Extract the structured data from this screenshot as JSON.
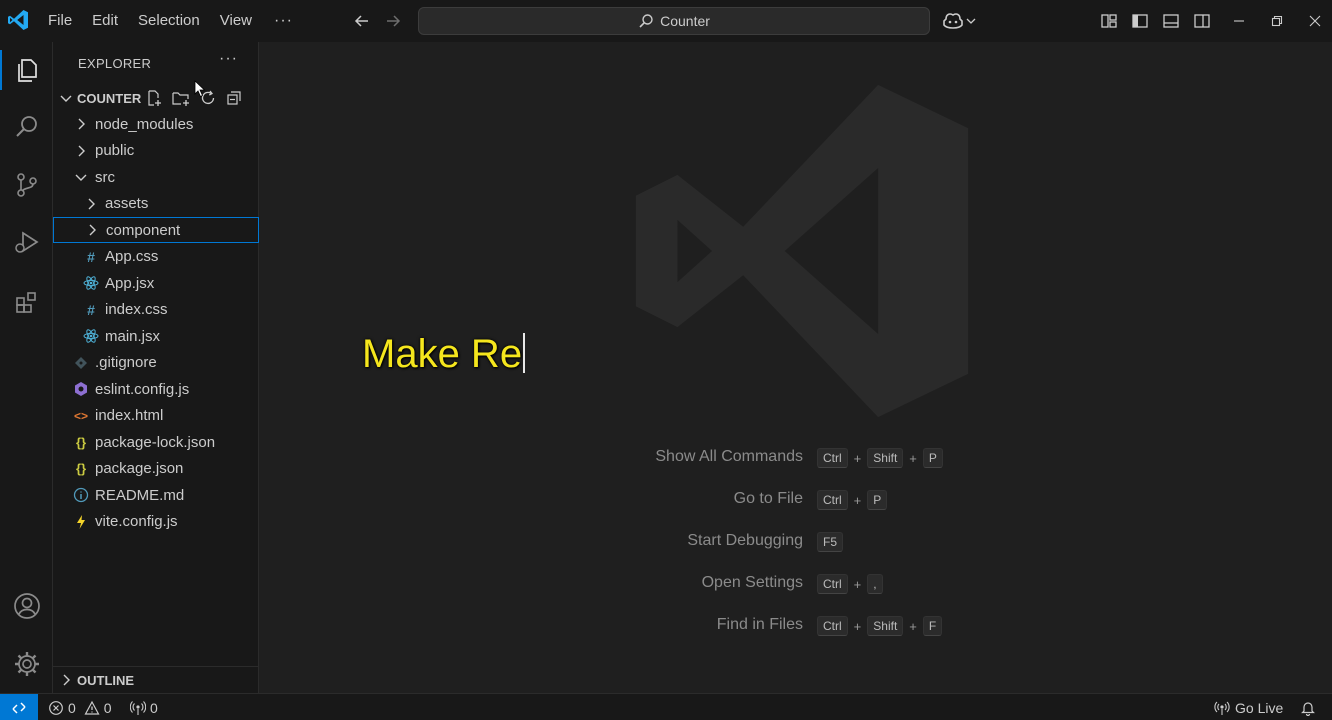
{
  "titlebar": {
    "menus": [
      "File",
      "Edit",
      "Selection",
      "View"
    ],
    "more": "···",
    "search_text": "Counter"
  },
  "sidebar": {
    "title": "EXPLORER",
    "more": "···",
    "project": "COUNTER",
    "tree": [
      {
        "label": "node_modules",
        "kind": "folder",
        "expanded": false,
        "depth": 0
      },
      {
        "label": "public",
        "kind": "folder",
        "expanded": false,
        "depth": 0
      },
      {
        "label": "src",
        "kind": "folder",
        "expanded": true,
        "depth": 0
      },
      {
        "label": "assets",
        "kind": "folder",
        "expanded": false,
        "depth": 1
      },
      {
        "label": "component",
        "kind": "folder",
        "expanded": false,
        "depth": 1,
        "selected": true
      },
      {
        "label": "App.css",
        "kind": "css",
        "depth": 1
      },
      {
        "label": "App.jsx",
        "kind": "react",
        "depth": 1
      },
      {
        "label": "index.css",
        "kind": "css",
        "depth": 1
      },
      {
        "label": "main.jsx",
        "kind": "react",
        "depth": 1
      },
      {
        "label": ".gitignore",
        "kind": "git",
        "depth": 0
      },
      {
        "label": "eslint.config.js",
        "kind": "eslint",
        "depth": 0
      },
      {
        "label": "index.html",
        "kind": "html",
        "depth": 0
      },
      {
        "label": "package-lock.json",
        "kind": "json",
        "depth": 0
      },
      {
        "label": "package.json",
        "kind": "json",
        "depth": 0
      },
      {
        "label": "README.md",
        "kind": "info",
        "depth": 0
      },
      {
        "label": "vite.config.js",
        "kind": "vite",
        "depth": 0
      }
    ],
    "outline": "OUTLINE"
  },
  "editor": {
    "caption": "Make Re",
    "shortcuts": [
      {
        "label": "Show All Commands",
        "keys": [
          "Ctrl",
          "Shift",
          "P"
        ]
      },
      {
        "label": "Go to File",
        "keys": [
          "Ctrl",
          "P"
        ]
      },
      {
        "label": "Start Debugging",
        "keys": [
          "F5"
        ]
      },
      {
        "label": "Open Settings",
        "keys": [
          "Ctrl",
          ","
        ]
      },
      {
        "label": "Find in Files",
        "keys": [
          "Ctrl",
          "Shift",
          "F"
        ]
      }
    ]
  },
  "statusbar": {
    "errors": "0",
    "warnings": "0",
    "ports": "0",
    "go_live": "Go Live"
  },
  "colors": {
    "accent": "#0078d4",
    "caption": "#f5e61d",
    "css_icon": "#519aba",
    "react_icon": "#4fb3d9",
    "json_icon": "#cbcb41",
    "html_icon": "#e37933",
    "eslint_icon": "#8d6fd1",
    "vite_icon": "#f5d42a"
  }
}
